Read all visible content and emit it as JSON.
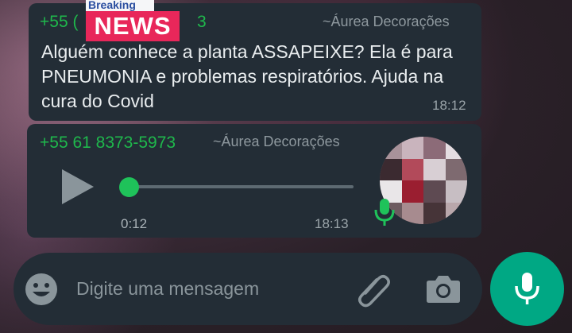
{
  "message1": {
    "sender": "+55 61 8373-5973",
    "sender_visible_prefix": "+55 (",
    "sender_visible_suffix": "3",
    "pushname": "~Áurea Decorações",
    "text": "Alguém conhece a planta ASSAPEIXE?  Ela é para PNEUMONIA e problemas respiratórios. Ajuda na cura do Covid",
    "time": "18:12"
  },
  "overlay_badge": {
    "top_text": "Breaking",
    "main_text": "NEWS",
    "top_color": "#2a4ea0",
    "main_bg": "#e8275a"
  },
  "message2": {
    "sender": "+55 61 8373-5973",
    "pushname": "~Áurea Decorações",
    "audio_elapsed": "0:12",
    "time": "18:13",
    "playback_progress": 0.0,
    "play_icon": "play-icon",
    "mic_icon": "microphone-icon"
  },
  "composer": {
    "placeholder": "Digite uma mensagem",
    "emoji_icon": "emoji-icon",
    "attach_icon": "paperclip-icon",
    "camera_icon": "camera-icon",
    "send_icon": "microphone-icon"
  },
  "colors": {
    "bubble": "#232d36",
    "accent_green": "#1fb84c",
    "fab": "#00a884",
    "text": "#e9edef",
    "muted": "#8e989e"
  }
}
